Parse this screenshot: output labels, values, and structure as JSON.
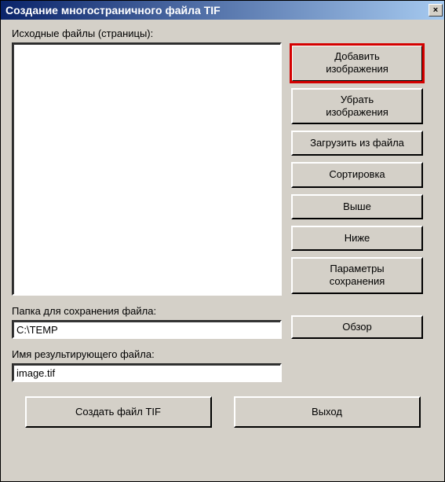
{
  "title": "Создание многостраничного файла TIF",
  "close_glyph": "×",
  "labels": {
    "source_files": "Исходные файлы (страницы):",
    "save_folder": "Папка для сохранения файла:",
    "result_name": "Имя результирующего файла:"
  },
  "inputs": {
    "save_folder_value": "C:\\TEMP",
    "result_name_value": "image.tif"
  },
  "buttons": {
    "add_images": "Добавить\nизображения",
    "remove_images": "Убрать\nизображения",
    "load_from_file": "Загрузить из файла",
    "sort": "Сортировка",
    "up": "Выше",
    "down": "Ниже",
    "save_params": "Параметры\nсохранения",
    "browse": "Обзор",
    "create_tif": "Создать файл TIF",
    "exit": "Выход"
  }
}
